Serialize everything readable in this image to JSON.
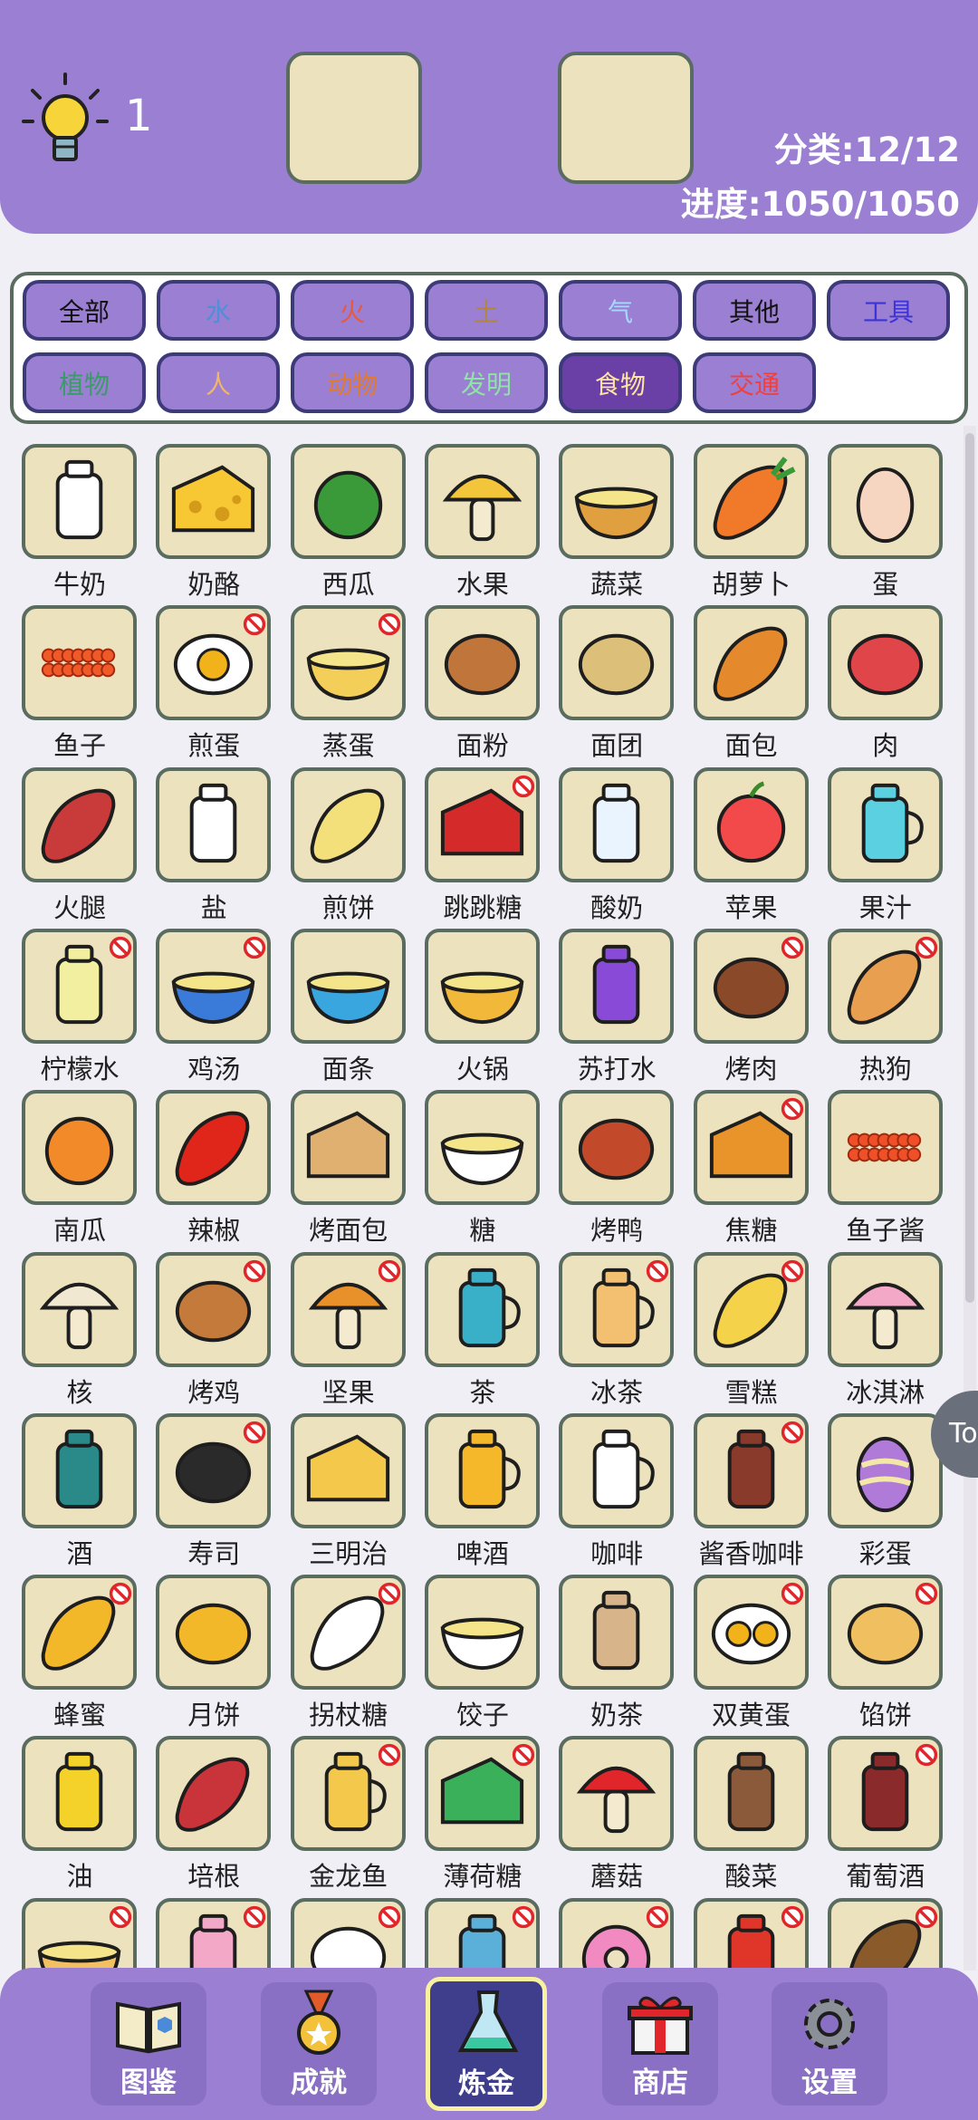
{
  "header": {
    "hint_count": "1",
    "category_progress": "分类:12/12",
    "progress": "进度:1050/1050"
  },
  "categories": [
    {
      "label": "全部",
      "color": "#111111"
    },
    {
      "label": "水",
      "color": "#4f8ed8"
    },
    {
      "label": "火",
      "color": "#e85a3a"
    },
    {
      "label": "土",
      "color": "#b08640"
    },
    {
      "label": "气",
      "color": "#a8d8ff"
    },
    {
      "label": "其他",
      "color": "#111111"
    },
    {
      "label": "工具",
      "color": "#3c34d6"
    },
    {
      "label": "植物",
      "color": "#3c9a6a"
    },
    {
      "label": "人",
      "color": "#f3b56a"
    },
    {
      "label": "动物",
      "color": "#e07a30"
    },
    {
      "label": "发明",
      "color": "#8fe3a4"
    },
    {
      "label": "食物",
      "color": "#ffe3a0"
    },
    {
      "label": "交通",
      "color": "#ef4040"
    }
  ],
  "active_category": "食物",
  "items": [
    {
      "label": "牛奶",
      "icon": "milk-icon",
      "locked": false
    },
    {
      "label": "奶酪",
      "icon": "cheese-icon",
      "locked": false
    },
    {
      "label": "西瓜",
      "icon": "watermelon-icon",
      "locked": false
    },
    {
      "label": "水果",
      "icon": "pineapple-icon",
      "locked": false
    },
    {
      "label": "蔬菜",
      "icon": "cornucopia-icon",
      "locked": false
    },
    {
      "label": "胡萝卜",
      "icon": "carrot-icon",
      "locked": false
    },
    {
      "label": "蛋",
      "icon": "eggs-icon",
      "locked": false
    },
    {
      "label": "鱼子",
      "icon": "roe-icon",
      "locked": false
    },
    {
      "label": "煎蛋",
      "icon": "fried-egg-icon",
      "locked": true
    },
    {
      "label": "蒸蛋",
      "icon": "steamed-egg-icon",
      "locked": true
    },
    {
      "label": "面粉",
      "icon": "flour-sack-icon",
      "locked": false
    },
    {
      "label": "面团",
      "icon": "dough-icon",
      "locked": false
    },
    {
      "label": "面包",
      "icon": "bread-icon",
      "locked": false
    },
    {
      "label": "肉",
      "icon": "steak-icon",
      "locked": false
    },
    {
      "label": "火腿",
      "icon": "sausage-icon",
      "locked": false
    },
    {
      "label": "盐",
      "icon": "salt-shaker-icon",
      "locked": false
    },
    {
      "label": "煎饼",
      "icon": "pancake-wrap-icon",
      "locked": false
    },
    {
      "label": "跳跳糖",
      "icon": "pop-rocks-icon",
      "locked": true
    },
    {
      "label": "酸奶",
      "icon": "yogurt-icon",
      "locked": false
    },
    {
      "label": "苹果",
      "icon": "apple-icon",
      "locked": false
    },
    {
      "label": "果汁",
      "icon": "juice-jar-icon",
      "locked": false
    },
    {
      "label": "柠檬水",
      "icon": "lemonade-icon",
      "locked": true
    },
    {
      "label": "鸡汤",
      "icon": "soup-bowl-icon",
      "locked": true
    },
    {
      "label": "面条",
      "icon": "noodles-icon",
      "locked": false
    },
    {
      "label": "火锅",
      "icon": "hotpot-icon",
      "locked": false
    },
    {
      "label": "苏打水",
      "icon": "soda-cup-icon",
      "locked": false
    },
    {
      "label": "烤肉",
      "icon": "grilled-meat-icon",
      "locked": true
    },
    {
      "label": "热狗",
      "icon": "hotdog-icon",
      "locked": true
    },
    {
      "label": "南瓜",
      "icon": "pumpkin-icon",
      "locked": false
    },
    {
      "label": "辣椒",
      "icon": "chili-icon",
      "locked": false
    },
    {
      "label": "烤面包",
      "icon": "toast-icon",
      "locked": false
    },
    {
      "label": "糖",
      "icon": "sugar-bowl-icon",
      "locked": false
    },
    {
      "label": "烤鸭",
      "icon": "roast-duck-icon",
      "locked": false
    },
    {
      "label": "焦糖",
      "icon": "caramel-icon",
      "locked": true
    },
    {
      "label": "鱼子酱",
      "icon": "caviar-icon",
      "locked": false
    },
    {
      "label": "核",
      "icon": "apple-core-icon",
      "locked": false
    },
    {
      "label": "烤鸡",
      "icon": "roast-chicken-icon",
      "locked": true
    },
    {
      "label": "坚果",
      "icon": "acorn-icon",
      "locked": true
    },
    {
      "label": "茶",
      "icon": "tea-mug-icon",
      "locked": false
    },
    {
      "label": "冰茶",
      "icon": "iced-tea-pitcher-icon",
      "locked": true
    },
    {
      "label": "雪糕",
      "icon": "popsicle-icon",
      "locked": true
    },
    {
      "label": "冰淇淋",
      "icon": "ice-cream-cone-icon",
      "locked": false
    },
    {
      "label": "酒",
      "icon": "wine-bottle-icon",
      "locked": false
    },
    {
      "label": "寿司",
      "icon": "sushi-icon",
      "locked": true
    },
    {
      "label": "三明治",
      "icon": "sandwich-icon",
      "locked": false
    },
    {
      "label": "啤酒",
      "icon": "beer-mug-icon",
      "locked": false
    },
    {
      "label": "咖啡",
      "icon": "coffee-cup-icon",
      "locked": false
    },
    {
      "label": "酱香咖啡",
      "icon": "coffee-takeaway-icon",
      "locked": true
    },
    {
      "label": "彩蛋",
      "icon": "easter-egg-icon",
      "locked": false
    },
    {
      "label": "蜂蜜",
      "icon": "honey-dipper-icon",
      "locked": true
    },
    {
      "label": "月饼",
      "icon": "mooncake-icon",
      "locked": false
    },
    {
      "label": "拐杖糖",
      "icon": "candy-cane-icon",
      "locked": true
    },
    {
      "label": "饺子",
      "icon": "dumplings-icon",
      "locked": false
    },
    {
      "label": "奶茶",
      "icon": "bubble-tea-icon",
      "locked": false
    },
    {
      "label": "双黄蛋",
      "icon": "double-yolk-icon",
      "locked": true
    },
    {
      "label": "馅饼",
      "icon": "pie-icon",
      "locked": true
    },
    {
      "label": "油",
      "icon": "oil-bottle-icon",
      "locked": false
    },
    {
      "label": "培根",
      "icon": "bacon-icon",
      "locked": false
    },
    {
      "label": "金龙鱼",
      "icon": "oil-jug-icon",
      "locked": true
    },
    {
      "label": "薄荷糖",
      "icon": "mint-candy-icon",
      "locked": true
    },
    {
      "label": "蘑菇",
      "icon": "mushroom-icon",
      "locked": false
    },
    {
      "label": "酸菜",
      "icon": "pickle-jar-icon",
      "locked": false
    },
    {
      "label": "葡萄酒",
      "icon": "red-wine-icon",
      "locked": true
    },
    {
      "label": "",
      "icon": "soup-pot-icon",
      "locked": true
    },
    {
      "label": "",
      "icon": "milkshake-icon",
      "locked": true
    },
    {
      "label": "",
      "icon": "candy-icon",
      "locked": true
    },
    {
      "label": "",
      "icon": "jar-icon",
      "locked": true
    },
    {
      "label": "",
      "icon": "donut-icon",
      "locked": true
    },
    {
      "label": "",
      "icon": "cup-noodles-icon",
      "locked": true
    },
    {
      "label": "",
      "icon": "jerky-icon",
      "locked": true
    }
  ],
  "side_button_label": "To",
  "bottom_nav": [
    {
      "label": "图鉴",
      "icon": "book-icon",
      "active": false
    },
    {
      "label": "成就",
      "icon": "medal-icon",
      "active": false
    },
    {
      "label": "炼金",
      "icon": "flask-icon",
      "active": true
    },
    {
      "label": "商店",
      "icon": "gift-icon",
      "active": false
    },
    {
      "label": "设置",
      "icon": "gear-icon",
      "active": false
    }
  ]
}
